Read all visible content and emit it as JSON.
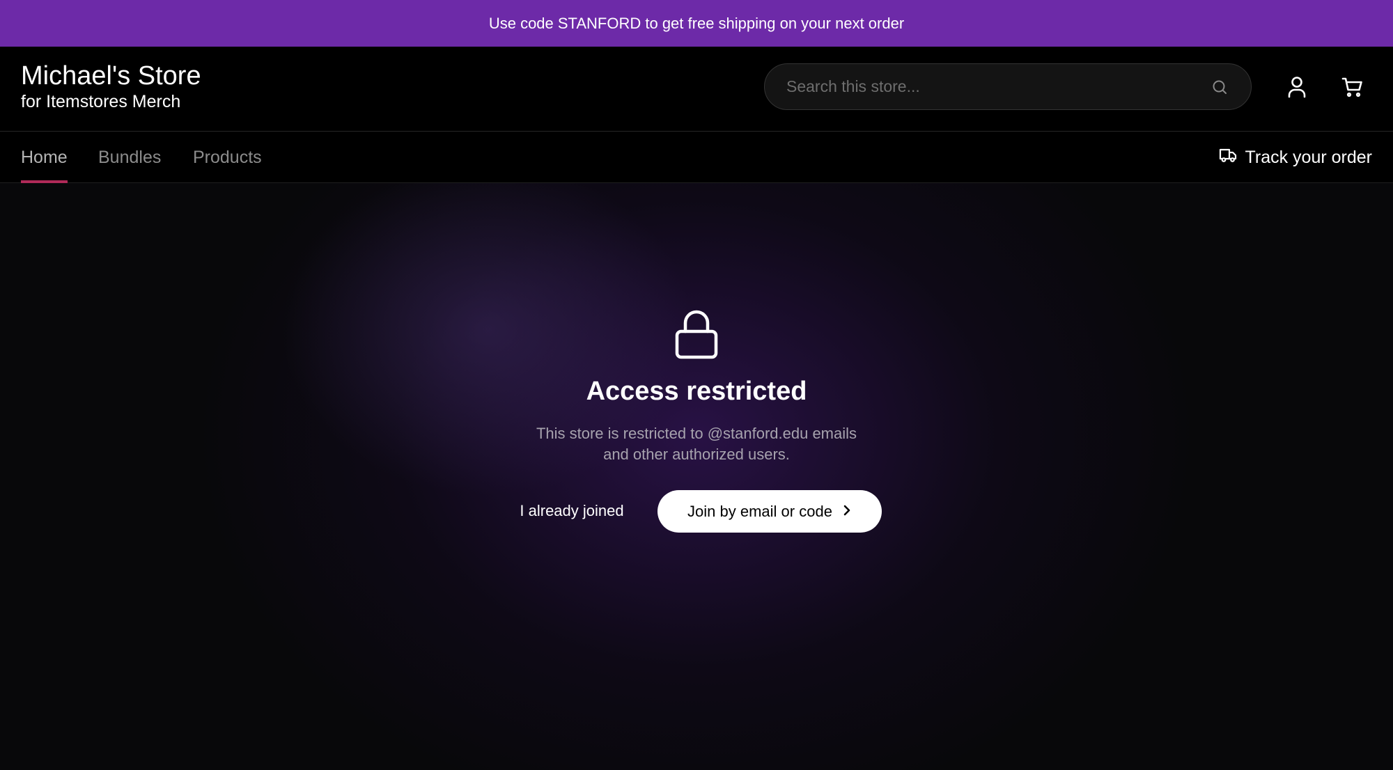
{
  "promo_banner": {
    "text": "Use code STANFORD to get free shipping on your next order",
    "background": "#6d2aa8"
  },
  "header": {
    "store_name": "Michael's Store",
    "store_subtitle": "for Itemstores Merch",
    "search": {
      "placeholder": "Search this store...",
      "value": "",
      "icon": "search-icon"
    },
    "account_icon": "user-icon",
    "cart_icon": "cart-icon"
  },
  "nav": {
    "items": [
      {
        "label": "Home",
        "active": true
      },
      {
        "label": "Bundles",
        "active": false
      },
      {
        "label": "Products",
        "active": false
      }
    ],
    "active_underline_color": "#b02a58",
    "track_order": {
      "label": "Track your order",
      "icon": "truck-icon"
    }
  },
  "main": {
    "icon": "lock-icon",
    "heading": "Access restricted",
    "description_line1": "This store is restricted to @stanford.edu emails",
    "description_line2": "and other authorized users.",
    "secondary_button": "I already joined",
    "primary_button": {
      "label": "Join by email or code",
      "icon": "chevron-right-icon"
    }
  }
}
